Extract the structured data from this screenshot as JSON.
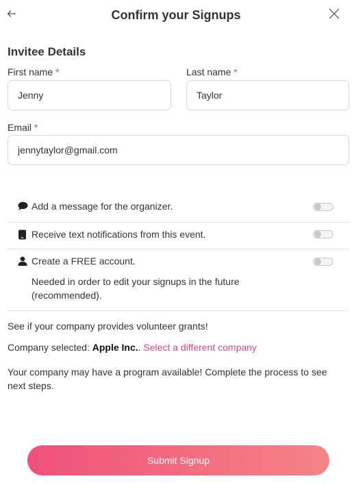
{
  "header": {
    "title": "Confirm your Signups"
  },
  "invitee": {
    "section_title": "Invitee Details",
    "first_name": {
      "label": "First name",
      "required_mark": "*",
      "value": "Jenny"
    },
    "last_name": {
      "label": "Last name",
      "required_mark": "*",
      "value": "Taylor"
    },
    "email": {
      "label": "Email",
      "required_mark": "*",
      "value": "jennytaylor@gmail.com"
    }
  },
  "options": [
    {
      "icon": "speech-bubble-icon",
      "label": "Add a message for the organizer.",
      "enabled": false
    },
    {
      "icon": "phone-icon",
      "label": "Receive text notifications from this event.",
      "enabled": false
    },
    {
      "icon": "user-icon",
      "label": "Create a FREE account.",
      "sublabel": "Needed in order to edit your signups in the future (recommended).",
      "enabled": false
    }
  ],
  "grants": {
    "intro": "See if your company provides volunteer grants!",
    "company_prefix": "Company selected: ",
    "company_name": "Apple Inc.",
    "company_suffix": ". ",
    "change_link": "Select a different company",
    "program_note": "Your company may have a program available! Complete the process to see next steps."
  },
  "submit_label": "Submit Signup",
  "colors": {
    "accent": "#e0457b",
    "button_gradient_start": "#f0507a",
    "button_gradient_end": "#f48486"
  }
}
